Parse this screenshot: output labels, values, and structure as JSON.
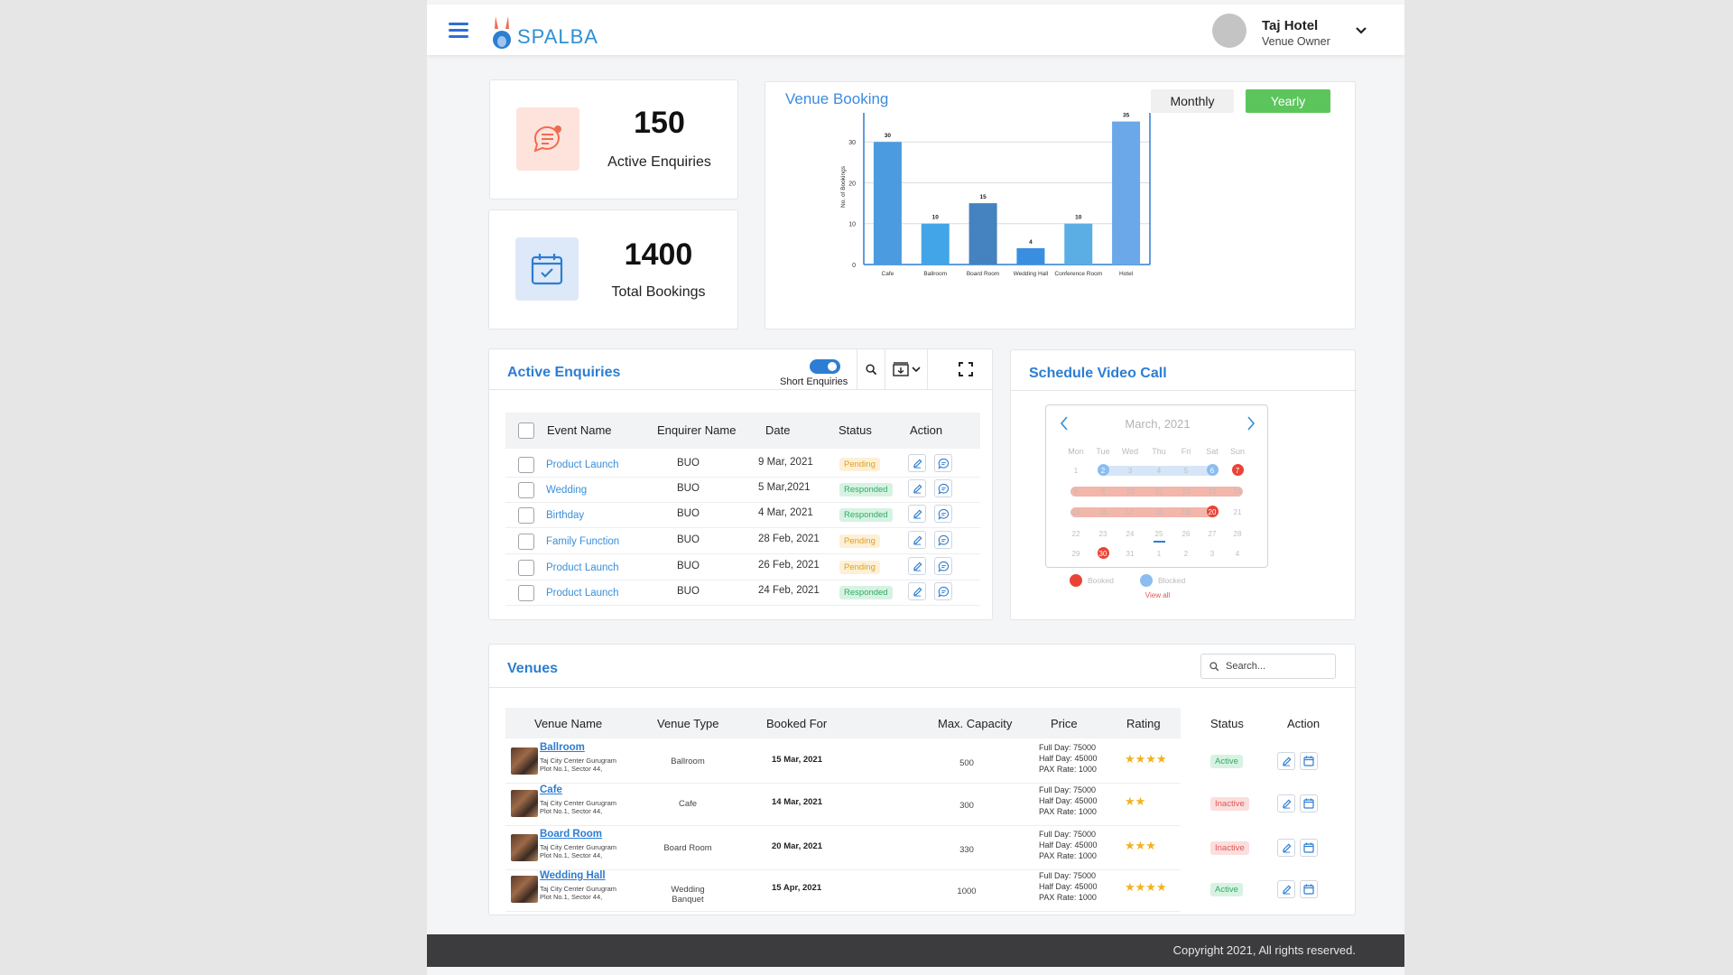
{
  "header": {
    "brand": "SPALBA",
    "user_name": "Taj Hotel",
    "user_role": "Venue Owner"
  },
  "stats": [
    {
      "value": "150",
      "label": "Active Enquiries",
      "icon": "chat-icon",
      "color": "#f26b4f"
    },
    {
      "value": "1400",
      "label": "Total Bookings",
      "icon": "calendar-check-icon",
      "color": "#2d7dd2"
    }
  ],
  "venue_booking": {
    "title": "Venue Booking",
    "toggle": {
      "monthly": "Monthly",
      "yearly": "Yearly",
      "active": "Yearly"
    },
    "chart_data": {
      "type": "bar",
      "categories": [
        "Cafe",
        "Ballroom",
        "Board Room",
        "Wedding Hall",
        "Conference Room",
        "Hotel"
      ],
      "values": [
        30,
        10,
        15,
        4,
        10,
        35
      ],
      "data_labels": [
        "30",
        "10",
        "15",
        "4",
        "10",
        "35"
      ],
      "ylabel": "No. of Bookings",
      "yticks": [
        0,
        10,
        20,
        30
      ],
      "ylim": [
        0,
        38
      ],
      "colors": [
        "#4a9be0",
        "#42a5e8",
        "#4582c0",
        "#3a8ee0",
        "#5aaee4",
        "#6aa8ea"
      ],
      "grid": true
    }
  },
  "enquiries": {
    "title": "Active Enquiries",
    "toggle_label": "Short Enquiries",
    "columns": [
      "Event Name",
      "Enquirer Name",
      "Date",
      "Status",
      "Action"
    ],
    "rows": [
      {
        "event": "Product Launch",
        "enquirer": "BUO",
        "date": "9 Mar, 2021",
        "status": "Pending"
      },
      {
        "event": "Wedding",
        "enquirer": "BUO",
        "date": "5 Mar,2021",
        "status": "Responded"
      },
      {
        "event": "Birthday",
        "enquirer": "BUO",
        "date": "4 Mar, 2021",
        "status": "Responded"
      },
      {
        "event": "Family Function",
        "enquirer": "BUO",
        "date": "28 Feb, 2021",
        "status": "Pending"
      },
      {
        "event": "Product Launch",
        "enquirer": "BUO",
        "date": "26 Feb, 2021",
        "status": "Pending"
      },
      {
        "event": "Product Launch",
        "enquirer": "BUO",
        "date": "24 Feb, 2021",
        "status": "Responded"
      }
    ]
  },
  "schedule": {
    "title": "Schedule Video Call",
    "month": "March, 2021",
    "days": [
      "Mon",
      "Tue",
      "Wed",
      "Thu",
      "Fri",
      "Sat",
      "Sun"
    ],
    "weeks": [
      [
        "1",
        "2",
        "3",
        "4",
        "5",
        "6",
        "7"
      ],
      [
        "8",
        "9",
        "10",
        "11",
        "12",
        "13",
        "14"
      ],
      [
        "15",
        "16",
        "17",
        "18",
        "19",
        "20",
        "21"
      ],
      [
        "22",
        "23",
        "24",
        "25",
        "26",
        "27",
        "28"
      ],
      [
        "29",
        "30",
        "31",
        "1",
        "2",
        "3",
        "4"
      ]
    ],
    "legend_booked": "Booked",
    "legend_blocked": "Blocked",
    "view_all": "View all"
  },
  "venues": {
    "title": "Venues",
    "search_placeholder": "Search...",
    "columns": [
      "Venue Name",
      "Venue Type",
      "Booked For",
      "Max. Capacity",
      "Price",
      "Rating",
      "Status",
      "Action"
    ],
    "rows": [
      {
        "name": "Ballroom",
        "addr1": "Taj City Center Gurugram",
        "addr2": "Plot No.1, Sector 44,",
        "type": "Ballroom",
        "booked_for": "15 Mar, 2021",
        "capacity": "500",
        "full_day": "Full Day: 75000",
        "half_day": "Half Day: 45000",
        "pax": "PAX Rate: 1000",
        "rating": "★★★★",
        "status": "Active"
      },
      {
        "name": "Cafe",
        "addr1": "Taj City Center Gurugram",
        "addr2": "Plot No.1, Sector 44,",
        "type": "Cafe",
        "booked_for": "14 Mar, 2021",
        "capacity": "300",
        "full_day": "Full Day: 75000",
        "half_day": "Half Day: 45000",
        "pax": "PAX Rate: 1000",
        "rating": "★★",
        "status": "Inactive"
      },
      {
        "name": "Board Room",
        "addr1": "Taj City Center Gurugram",
        "addr2": "Plot No.1, Sector 44,",
        "type": "Board Room",
        "booked_for": "20 Mar, 2021",
        "capacity": "330",
        "full_day": "Full Day: 75000",
        "half_day": "Half Day: 45000",
        "pax": "PAX Rate: 1000",
        "rating": "★★★",
        "status": "Inactive"
      },
      {
        "name": "Wedding Hall",
        "addr1": "Taj City Center Gurugram",
        "addr2": "Plot No.1, Sector 44,",
        "type": "Wedding Banquet",
        "booked_for": "15 Apr, 2021",
        "capacity": "1000",
        "full_day": "Full Day: 75000",
        "half_day": "Half Day: 45000",
        "pax": "PAX Rate: 1000",
        "rating": "★★★★",
        "status": "Active"
      }
    ]
  },
  "footer": {
    "copyright": "Copyright 2021, All rights reserved."
  }
}
